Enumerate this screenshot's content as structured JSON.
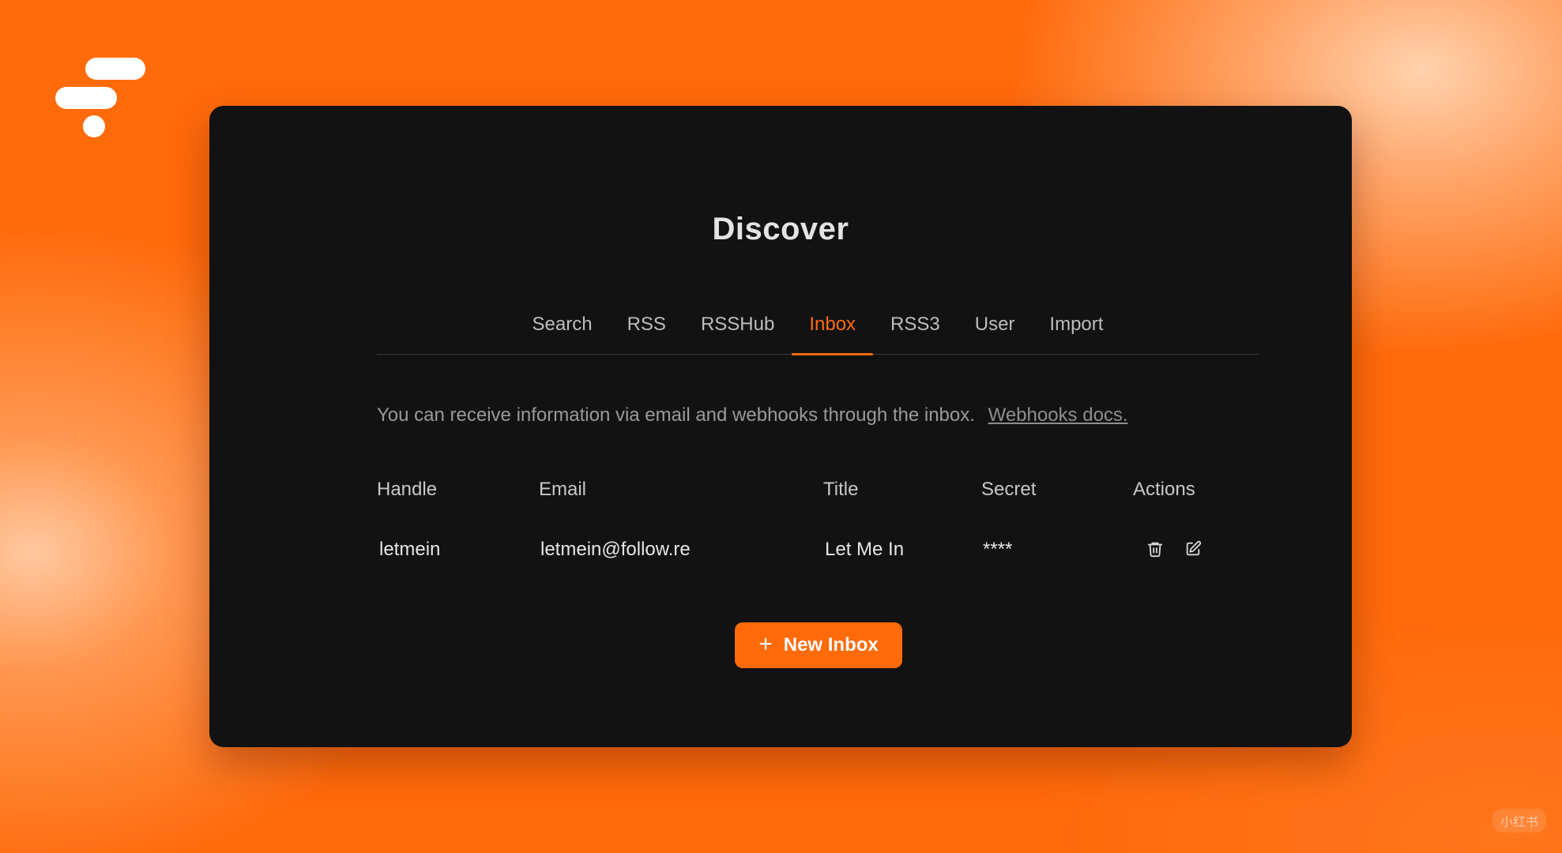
{
  "page": {
    "title": "Discover",
    "tabs": [
      {
        "label": "Search",
        "active": false
      },
      {
        "label": "RSS",
        "active": false
      },
      {
        "label": "RSSHub",
        "active": false
      },
      {
        "label": "Inbox",
        "active": true
      },
      {
        "label": "RSS3",
        "active": false
      },
      {
        "label": "User",
        "active": false
      },
      {
        "label": "Import",
        "active": false
      }
    ],
    "description": "You can receive information via email and webhooks through the inbox.",
    "docs_link": "Webhooks docs."
  },
  "table": {
    "headers": [
      "Handle",
      "Email",
      "Title",
      "Secret",
      "Actions"
    ],
    "rows": [
      {
        "handle": "letmein",
        "email": "letmein@follow.re",
        "title": "Let Me In",
        "secret": "****"
      }
    ],
    "actions": [
      "trash-icon",
      "edit-icon"
    ]
  },
  "new_button": {
    "icon": "+",
    "label": "New Inbox"
  },
  "watermark": "小红书",
  "colors": {
    "accent": "#ff6a10",
    "background": "#ff6a0a",
    "card": "#121212"
  }
}
